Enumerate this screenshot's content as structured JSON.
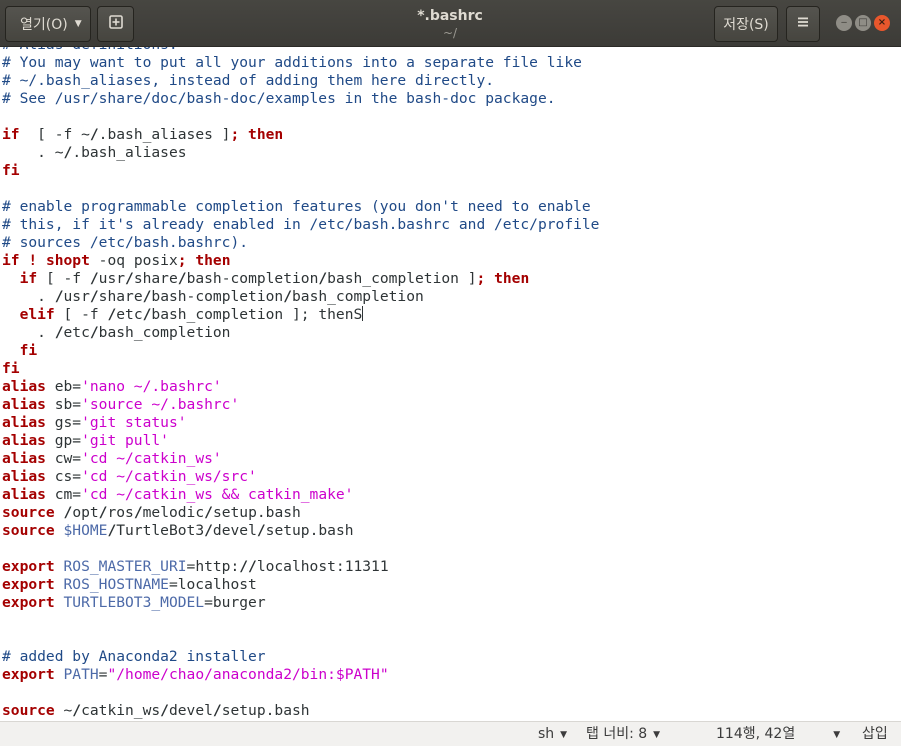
{
  "header": {
    "open_label": "열기(O)",
    "title": "*.bashrc",
    "subtitle": "~/",
    "save_label": "저장(S)",
    "menu_icon": "hamburger-menu-icon",
    "new_tab_icon": "new-document-icon"
  },
  "window_controls": {
    "minimize": "‒",
    "maximize": "□",
    "close": "×"
  },
  "editor": {
    "lines": [
      [
        [
          "cm",
          "# Alias definitions."
        ]
      ],
      [
        [
          "cm",
          "# You may want to put all your additions into a separate file like"
        ]
      ],
      [
        [
          "cm",
          "# ~/.bash_aliases, instead of adding them here directly."
        ]
      ],
      [
        [
          "cm",
          "# See /usr/share/doc/bash-doc/examples in the bash-doc package."
        ]
      ],
      [],
      [
        [
          "kw",
          "if"
        ],
        [
          "",
          "  [ -f ~"
        ],
        [
          "sl",
          "/"
        ],
        [
          "",
          ".bash_aliases ]"
        ],
        [
          "kw",
          "; then"
        ]
      ],
      [
        [
          "",
          "    . ~"
        ],
        [
          "sl",
          "/"
        ],
        [
          "",
          ".bash_aliases"
        ]
      ],
      [
        [
          "kw",
          "fi"
        ]
      ],
      [],
      [
        [
          "cm",
          "# enable programmable completion features (you don't need to enable"
        ]
      ],
      [
        [
          "cm",
          "# this, if it's already enabled in /etc/bash.bashrc and /etc/profile"
        ]
      ],
      [
        [
          "cm",
          "# sources /etc/bash.bashrc)."
        ]
      ],
      [
        [
          "kw",
          "if"
        ],
        [
          "",
          " "
        ],
        [
          "kw",
          "! shopt"
        ],
        [
          "",
          " -oq posix"
        ],
        [
          "kw",
          "; then"
        ]
      ],
      [
        [
          "",
          "  "
        ],
        [
          "kw",
          "if"
        ],
        [
          "",
          " [ -f "
        ],
        [
          "sl",
          "/"
        ],
        [
          "",
          "usr"
        ],
        [
          "sl",
          "/"
        ],
        [
          "",
          "share"
        ],
        [
          "sl",
          "/"
        ],
        [
          "",
          "bash-completion"
        ],
        [
          "sl",
          "/"
        ],
        [
          "",
          "bash_completion ]"
        ],
        [
          "kw",
          "; then"
        ]
      ],
      [
        [
          "",
          "    . "
        ],
        [
          "sl",
          "/"
        ],
        [
          "",
          "usr"
        ],
        [
          "sl",
          "/"
        ],
        [
          "",
          "share"
        ],
        [
          "sl",
          "/"
        ],
        [
          "",
          "bash-completion"
        ],
        [
          "sl",
          "/"
        ],
        [
          "",
          "bash_completion"
        ]
      ],
      [
        [
          "",
          "  "
        ],
        [
          "kw",
          "elif"
        ],
        [
          "",
          " [ -f "
        ],
        [
          "sl",
          "/"
        ],
        [
          "",
          "etc"
        ],
        [
          "sl",
          "/"
        ],
        [
          "",
          "bash_completion ]; thenS"
        ],
        [
          "cursor",
          ""
        ]
      ],
      [
        [
          "",
          "    . "
        ],
        [
          "sl",
          "/"
        ],
        [
          "",
          "etc"
        ],
        [
          "sl",
          "/"
        ],
        [
          "",
          "bash_completion"
        ]
      ],
      [
        [
          "",
          "  "
        ],
        [
          "kw",
          "fi"
        ]
      ],
      [
        [
          "kw",
          "fi"
        ]
      ],
      [
        [
          "kw",
          "alias"
        ],
        [
          "",
          " eb="
        ],
        [
          "st",
          "'nano ~/.bashrc'"
        ]
      ],
      [
        [
          "kw",
          "alias"
        ],
        [
          "",
          " sb="
        ],
        [
          "st",
          "'source ~/.bashrc'"
        ]
      ],
      [
        [
          "kw",
          "alias"
        ],
        [
          "",
          " gs="
        ],
        [
          "st",
          "'git status'"
        ]
      ],
      [
        [
          "kw",
          "alias"
        ],
        [
          "",
          " gp="
        ],
        [
          "st",
          "'git pull'"
        ]
      ],
      [
        [
          "kw",
          "alias"
        ],
        [
          "",
          " cw="
        ],
        [
          "st",
          "'cd ~/catkin_ws'"
        ]
      ],
      [
        [
          "kw",
          "alias"
        ],
        [
          "",
          " cs="
        ],
        [
          "st",
          "'cd ~/catkin_ws/src'"
        ]
      ],
      [
        [
          "kw",
          "alias"
        ],
        [
          "",
          " cm="
        ],
        [
          "st",
          "'cd ~/catkin_ws && catkin_make'"
        ]
      ],
      [
        [
          "kw",
          "source"
        ],
        [
          "",
          " "
        ],
        [
          "sl",
          "/"
        ],
        [
          "",
          "opt"
        ],
        [
          "sl",
          "/"
        ],
        [
          "",
          "ros"
        ],
        [
          "sl",
          "/"
        ],
        [
          "",
          "melodic"
        ],
        [
          "sl",
          "/"
        ],
        [
          "",
          "setup.bash"
        ]
      ],
      [
        [
          "kw",
          "source"
        ],
        [
          "",
          " "
        ],
        [
          "vr",
          "$HOME"
        ],
        [
          "sl",
          "/"
        ],
        [
          "",
          "TurtleBot3"
        ],
        [
          "sl",
          "/"
        ],
        [
          "",
          "devel"
        ],
        [
          "sl",
          "/"
        ],
        [
          "",
          "setup.bash"
        ]
      ],
      [],
      [
        [
          "kw",
          "export"
        ],
        [
          "",
          " "
        ],
        [
          "vr",
          "ROS_MASTER_URI"
        ],
        [
          "",
          "=http:"
        ],
        [
          "sl",
          "//"
        ],
        [
          "",
          "localhost:11311"
        ]
      ],
      [
        [
          "kw",
          "export"
        ],
        [
          "",
          " "
        ],
        [
          "vr",
          "ROS_HOSTNAME"
        ],
        [
          "",
          "=localhost"
        ]
      ],
      [
        [
          "kw",
          "export"
        ],
        [
          "",
          " "
        ],
        [
          "vr",
          "TURTLEBOT3_MODEL"
        ],
        [
          "",
          "=burger"
        ]
      ],
      [],
      [],
      [
        [
          "cm",
          "# added by Anaconda2 installer"
        ]
      ],
      [
        [
          "kw",
          "export"
        ],
        [
          "",
          " "
        ],
        [
          "vr",
          "PATH"
        ],
        [
          "",
          "="
        ],
        [
          "st",
          "\"/home/chao/anaconda2/bin:$PATH\""
        ]
      ],
      [],
      [
        [
          "kw",
          "source"
        ],
        [
          "",
          " ~"
        ],
        [
          "sl",
          "/"
        ],
        [
          "",
          "catkin_ws"
        ],
        [
          "sl",
          "/"
        ],
        [
          "",
          "devel"
        ],
        [
          "sl",
          "/"
        ],
        [
          "",
          "setup.bash"
        ]
      ]
    ]
  },
  "statusbar": {
    "language": "sh",
    "tab_width": "탭 너비: 8",
    "position": "114행, 42열",
    "mode": "삽입"
  }
}
